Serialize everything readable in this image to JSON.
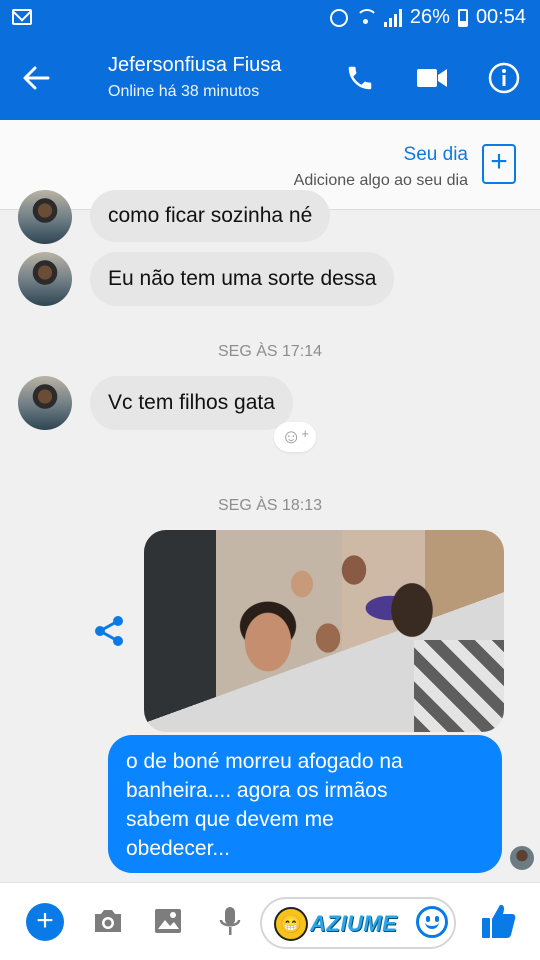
{
  "status_bar": {
    "battery": "26%",
    "time": "00:54"
  },
  "header": {
    "contact_name": "Jefersonfiusa Fiusa",
    "contact_status": "Online há 38 minutos"
  },
  "your_day": {
    "title": "Seu dia",
    "subtitle": "Adicione algo ao seu dia",
    "add_symbol": "+"
  },
  "messages": [
    {
      "direction": "incoming",
      "text": "como ficar sozinha né"
    },
    {
      "direction": "incoming",
      "text": "Eu não tem uma sorte dessa"
    },
    {
      "type": "timestamp",
      "text": "SEG ÀS 17:14"
    },
    {
      "direction": "incoming",
      "text": "Vc tem filhos gata"
    },
    {
      "type": "timestamp",
      "text": "SEG ÀS 18:13"
    },
    {
      "direction": "outgoing",
      "type": "photo"
    },
    {
      "direction": "outgoing",
      "text": "o de boné morreu afogado na\nbanheira.... agora os irmãos\nsabem que devem me\nobedecer..."
    }
  ],
  "composer": {
    "plus_symbol": "+",
    "brand_text": "AZIUME"
  },
  "colors": {
    "header_bg": "#0a6fdc",
    "outgoing_bubble": "#0a84ff",
    "incoming_bubble": "#e6e6e6",
    "accent": "#0a7be6"
  },
  "icons": [
    "mail-icon",
    "alarm-icon",
    "wifi-icon",
    "signal-icon",
    "battery-icon",
    "back-arrow-icon",
    "phone-icon",
    "video-camera-icon",
    "info-icon",
    "add-story-icon",
    "add-reaction-icon",
    "share-icon",
    "plus-icon",
    "camera-icon",
    "image-icon",
    "microphone-icon",
    "emoji-icon",
    "thumbs-up-icon"
  ]
}
